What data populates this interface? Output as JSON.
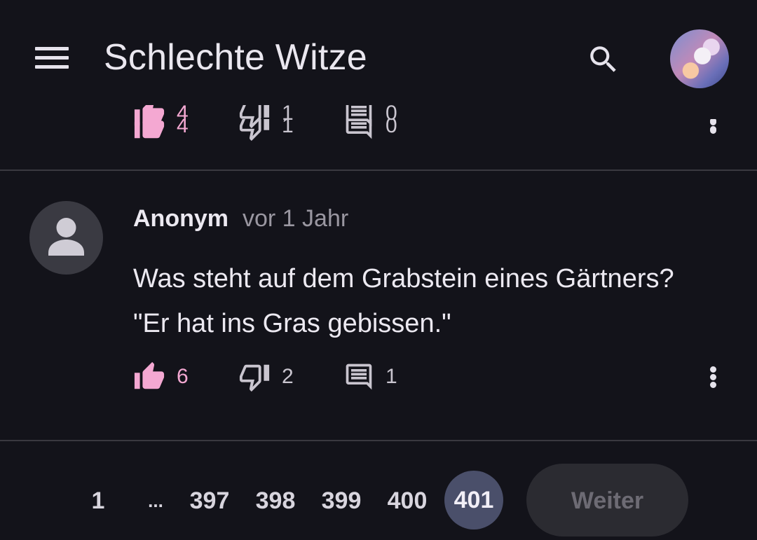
{
  "app": {
    "title": "Schlechte Witze"
  },
  "previous_post": {
    "likes": "4",
    "dislikes": "1",
    "comments": "0"
  },
  "post": {
    "author": "Anonym",
    "time": "vor 1 Jahr",
    "text_lines": [
      "Was steht auf dem Grabstein eines Gärtners?",
      "\"Er hat ins Gras gebissen.\""
    ],
    "likes": "6",
    "dislikes": "2",
    "comments": "1"
  },
  "pagination": {
    "first": "1",
    "ellipsis": "...",
    "pages": [
      "397",
      "398",
      "399",
      "400"
    ],
    "current": "401",
    "next_label": "Weiter"
  },
  "colors": {
    "background": "#13131a",
    "like_accent": "#f4a8d2",
    "current_page": "#4a4f6a"
  }
}
